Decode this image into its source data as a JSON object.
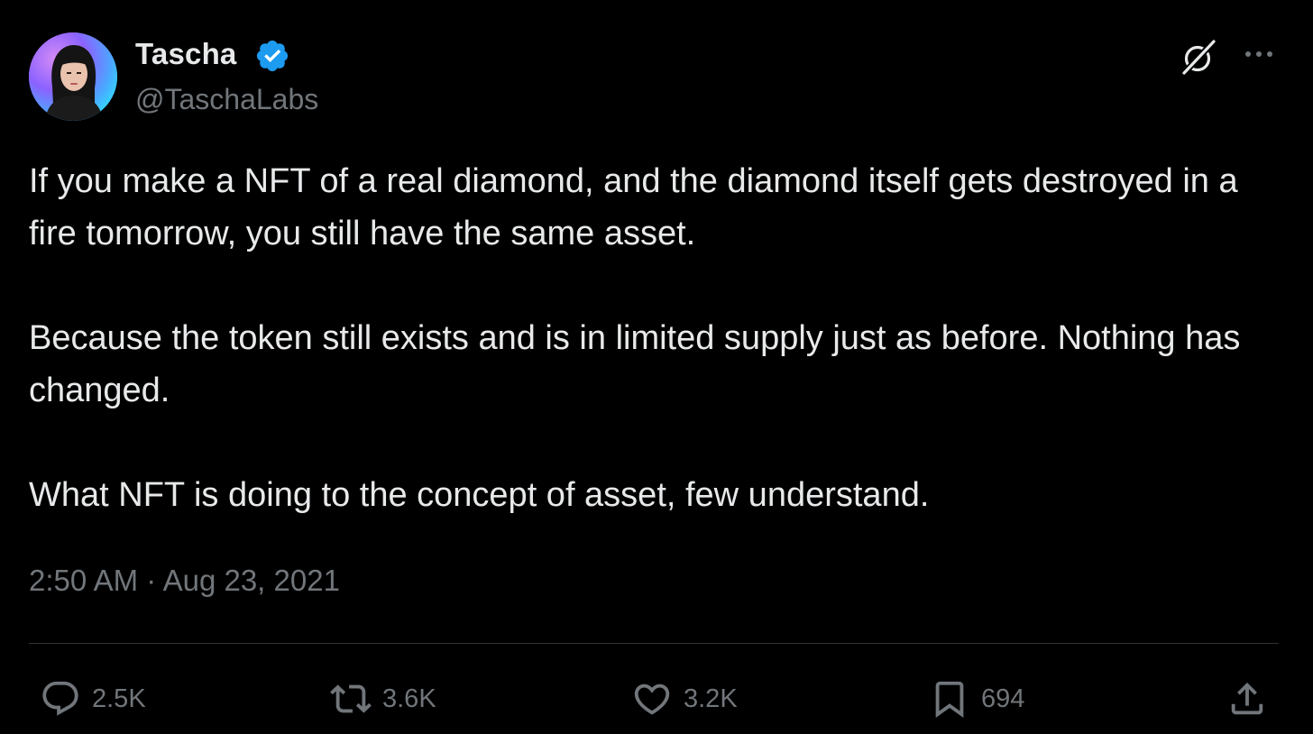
{
  "author": {
    "display_name": "Tascha",
    "handle": "@TaschaLabs",
    "verified": true,
    "verified_color": "#1d9bf0"
  },
  "header_icons": {
    "grok": "grok-icon",
    "more": "more-icon"
  },
  "tweet": {
    "paragraphs": [
      "If you make a NFT of a real diamond, and the diamond itself gets destroyed in a fire tomorrow, you still have the same asset.",
      "Because the token still exists and is in limited supply just as before. Nothing has changed.",
      "What NFT is doing to the concept of asset, few understand."
    ],
    "timestamp": "2:50 AM · Aug 23, 2021"
  },
  "actions": {
    "reply": {
      "icon": "reply-icon",
      "count": "2.5K"
    },
    "retweet": {
      "icon": "retweet-icon",
      "count": "3.6K"
    },
    "like": {
      "icon": "heart-icon",
      "count": "3.2K"
    },
    "bookmark": {
      "icon": "bookmark-icon",
      "count": "694"
    },
    "share": {
      "icon": "share-icon"
    }
  },
  "colors": {
    "background": "#000000",
    "primary_text": "#e7e9ea",
    "secondary_text": "#71767b",
    "divider": "#2f3336"
  }
}
